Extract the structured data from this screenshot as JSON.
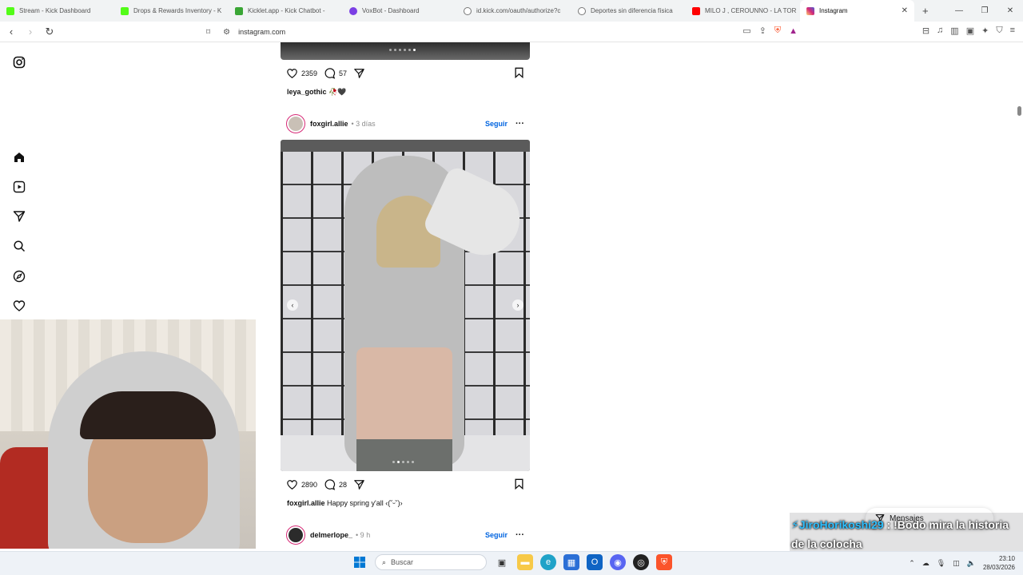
{
  "browser": {
    "tabs": [
      {
        "label": "Stream - Kick Dashboard",
        "color": "#53fc18"
      },
      {
        "label": "Drops & Rewards Inventory - K",
        "color": "#53fc18"
      },
      {
        "label": "Kicklet.app - Kick Chatbot -",
        "color": "#3aa635"
      },
      {
        "label": "VoxBot - Dashboard",
        "color": "#7b3fe4"
      },
      {
        "label": "id.kick.com/oauth/authorize?c",
        "color": "#777777"
      },
      {
        "label": "Deportes sin diferencia física",
        "color": "#777777"
      },
      {
        "label": "MILO J , CEROUNNO - LA TOR",
        "color": "#ff0000"
      },
      {
        "label": "Instagram",
        "color": "#d62976"
      }
    ],
    "url": "instagram.com"
  },
  "post_prev": {
    "likes": "2359",
    "comments": "57",
    "caption_user": "leya_gothic",
    "caption_text": " 🥀🖤"
  },
  "post_main": {
    "username": "foxgirl.allie",
    "time": " • 3 días",
    "follow": "Seguir",
    "likes": "2890",
    "comments": "28",
    "caption_user": "foxgirl.allie",
    "caption_text": " Happy spring y'all ‹(˘ᵕ˘)›"
  },
  "post_next": {
    "username": "delmerlope_",
    "time": " • 9 h",
    "follow": "Seguir"
  },
  "messages_label": "Mensajes",
  "chat": {
    "user": "JiroHorikoshi29",
    "text": " : !Bodo mira la historia de la colocha"
  },
  "taskbar": {
    "search_placeholder": "Buscar",
    "time": "23:10",
    "date": "28/03/2026"
  }
}
